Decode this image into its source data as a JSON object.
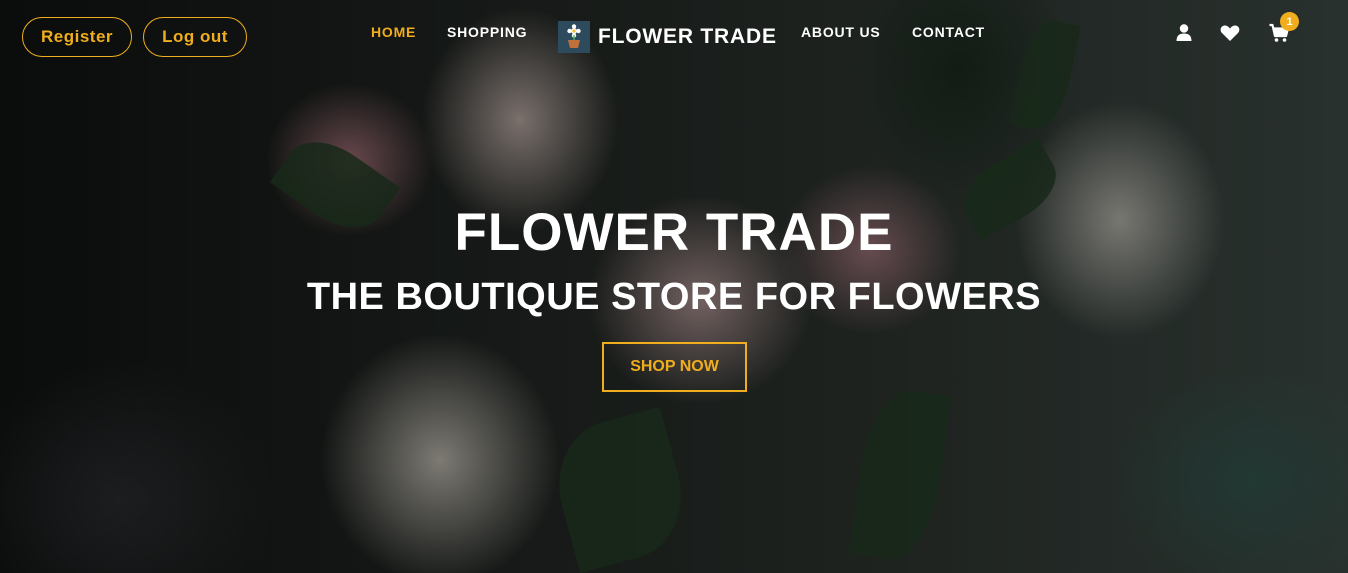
{
  "auth": {
    "register_label": "Register",
    "logout_label": "Log out"
  },
  "nav": {
    "home": "HOME",
    "shopping": "SHOPPING",
    "about": "ABOUT US",
    "contact": "CONTACT"
  },
  "brand": {
    "name": "FLOWER TRADE",
    "logo_icon": "flower-pot-icon"
  },
  "header_icons": {
    "user": "user-icon",
    "wishlist": "heart-icon",
    "cart": "cart-icon",
    "cart_count": "1"
  },
  "hero": {
    "title": "FLOWER TRADE",
    "subtitle": "THE BOUTIQUE STORE FOR FLOWERS",
    "cta_label": "SHOP NOW"
  },
  "colors": {
    "accent": "#f0ad1e",
    "text": "#ffffff",
    "logo_bg": "#2e4b5e"
  }
}
